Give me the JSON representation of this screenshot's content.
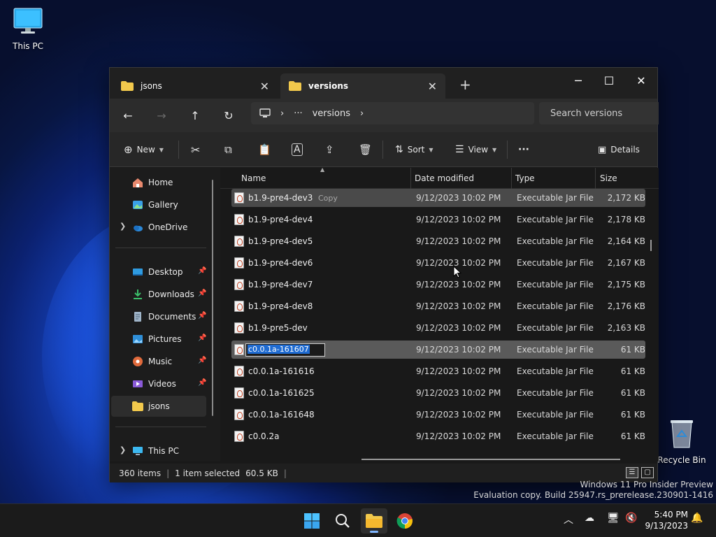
{
  "desktop": {
    "this_pc_label": "This PC",
    "recycle_bin_label": "Recycle Bin",
    "watermark_line1": "Windows 11 Pro Insider Preview",
    "watermark_line2": "Evaluation copy. Build 25947.rs_prerelease.230901-1416"
  },
  "tabs": [
    {
      "label": "jsons",
      "active": false
    },
    {
      "label": "versions",
      "active": true
    }
  ],
  "navbar": {
    "path_segment": "versions",
    "overflow_glyph": "···",
    "search_placeholder": "Search versions"
  },
  "toolbar": {
    "new_label": "New",
    "sort_label": "Sort",
    "view_label": "View",
    "more_glyph": "···",
    "details_label": "Details"
  },
  "sidebar": {
    "items": [
      {
        "label": "Home",
        "icon": "home-icon"
      },
      {
        "label": "Gallery",
        "icon": "gallery-icon"
      },
      {
        "label": "OneDrive",
        "icon": "onedrive-icon"
      },
      {
        "label": "Desktop",
        "icon": "desktop-folder-icon",
        "pinned": true
      },
      {
        "label": "Downloads",
        "icon": "downloads-icon",
        "pinned": true
      },
      {
        "label": "Documents",
        "icon": "documents-icon",
        "pinned": true
      },
      {
        "label": "Pictures",
        "icon": "pictures-icon",
        "pinned": true
      },
      {
        "label": "Music",
        "icon": "music-icon",
        "pinned": true
      },
      {
        "label": "Videos",
        "icon": "videos-icon",
        "pinned": true
      },
      {
        "label": "jsons",
        "icon": "folder-icon",
        "selected": true
      },
      {
        "label": "This PC",
        "icon": "this-pc-icon"
      }
    ]
  },
  "columns": {
    "name": "Name",
    "date": "Date modified",
    "type": "Type",
    "size": "Size"
  },
  "files": [
    {
      "name": "b1.9-pre4-dev3",
      "date": "9/12/2023 10:02 PM",
      "type": "Executable Jar File",
      "size": "2,172 KB",
      "state": "hover"
    },
    {
      "name": "b1.9-pre4-dev4",
      "date": "9/12/2023 10:02 PM",
      "type": "Executable Jar File",
      "size": "2,178 KB"
    },
    {
      "name": "b1.9-pre4-dev5",
      "date": "9/12/2023 10:02 PM",
      "type": "Executable Jar File",
      "size": "2,164 KB"
    },
    {
      "name": "b1.9-pre4-dev6",
      "date": "9/12/2023 10:02 PM",
      "type": "Executable Jar File",
      "size": "2,167 KB"
    },
    {
      "name": "b1.9-pre4-dev7",
      "date": "9/12/2023 10:02 PM",
      "type": "Executable Jar File",
      "size": "2,175 KB"
    },
    {
      "name": "b1.9-pre4-dev8",
      "date": "9/12/2023 10:02 PM",
      "type": "Executable Jar File",
      "size": "2,176 KB"
    },
    {
      "name": "b1.9-pre5-dev",
      "date": "9/12/2023 10:02 PM",
      "type": "Executable Jar File",
      "size": "2,163 KB"
    },
    {
      "name": "c0.0.1a-161607",
      "date": "9/12/2023 10:02 PM",
      "type": "Executable Jar File",
      "size": "61 KB",
      "state": "selected-renaming"
    },
    {
      "name": "c0.0.1a-161616",
      "date": "9/12/2023 10:02 PM",
      "type": "Executable Jar File",
      "size": "61 KB"
    },
    {
      "name": "c0.0.1a-161625",
      "date": "9/12/2023 10:02 PM",
      "type": "Executable Jar File",
      "size": "61 KB"
    },
    {
      "name": "c0.0.1a-161648",
      "date": "9/12/2023 10:02 PM",
      "type": "Executable Jar File",
      "size": "61 KB"
    },
    {
      "name": "c0.0.2a",
      "date": "9/12/2023 10:02 PM",
      "type": "Executable Jar File",
      "size": "61 KB"
    }
  ],
  "drag_ghost_label": "Copy",
  "status": {
    "item_count": "360 items",
    "selection": "1 item selected",
    "selection_size": "60.5 KB"
  },
  "clock": {
    "time": "5:40 PM",
    "date": "9/13/2023"
  },
  "colors": {
    "accent": "#1f6bd1",
    "folder": "#f2c94c",
    "window_bg": "#191919"
  }
}
